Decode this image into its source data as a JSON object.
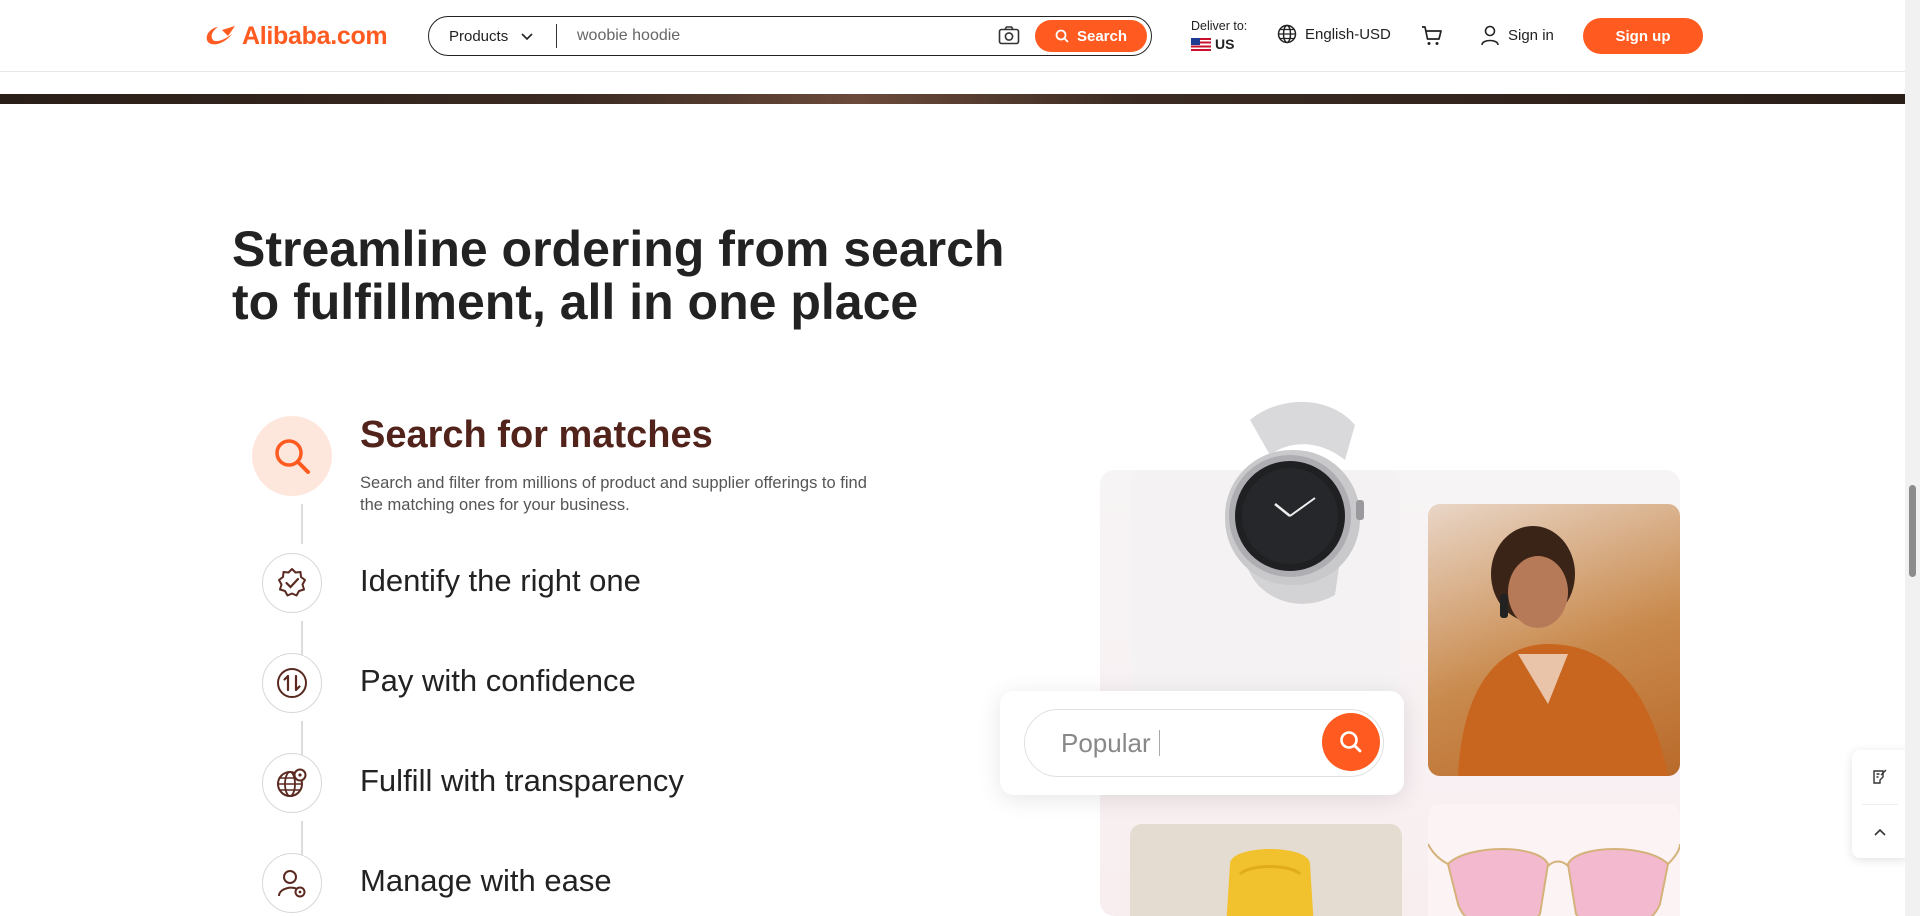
{
  "header": {
    "logo_text": "Alibaba.com",
    "search": {
      "category_label": "Products",
      "query": "woobie hoodie",
      "button_label": "Search"
    },
    "deliver": {
      "label": "Deliver to:",
      "country": "US"
    },
    "language": "English-USD",
    "signin_label": "Sign in",
    "signup_label": "Sign up"
  },
  "main": {
    "heading": "Streamline ordering from search to fulfillment, all in one place",
    "steps": [
      {
        "title": "Search for matches",
        "description": "Search and filter from millions of product and supplier offerings to find the matching ones for your business.",
        "icon": "search-icon",
        "active": true
      },
      {
        "title": "Identify the right one",
        "icon": "verified-badge-icon",
        "active": false
      },
      {
        "title": "Pay with confidence",
        "icon": "payment-exchange-icon",
        "active": false
      },
      {
        "title": "Fulfill with transparency",
        "icon": "globe-location-icon",
        "active": false
      },
      {
        "title": "Manage with ease",
        "icon": "user-settings-icon",
        "active": false
      }
    ],
    "illustration": {
      "search_placeholder": "Popular"
    }
  },
  "colors": {
    "brand": "#ff5a1f",
    "active_title": "#51231a",
    "active_icon_bg": "#fde7dc"
  }
}
